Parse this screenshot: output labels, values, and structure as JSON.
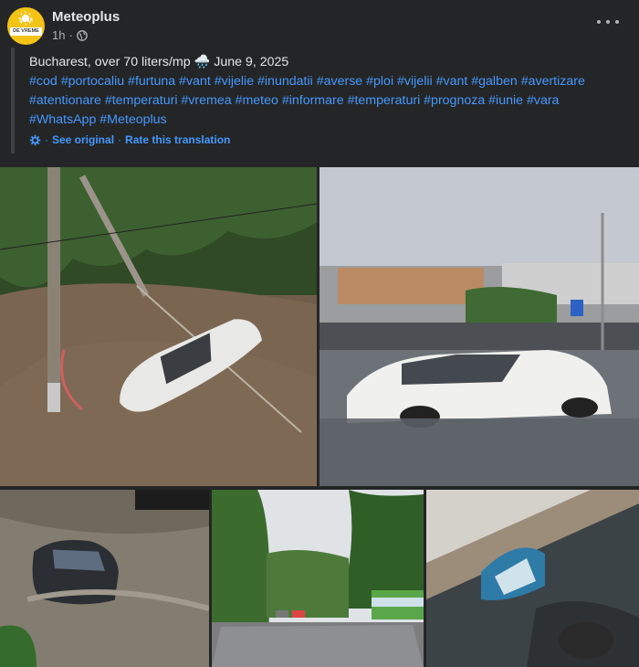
{
  "post": {
    "page_name": "Meteoplus",
    "time": "1h",
    "avatar_text_top": "Sunlit",
    "avatar_text_bottom": "DE VREME",
    "line1_text": "Bucharest, over 70 liters/mp",
    "line1_emoji": "🌧️",
    "line1_date": "June 9, 2025",
    "hashtags": "#cod #portocaliu #furtuna #vant #vijelie #inundatii #averse #ploi #vijelii #vant #galben #avertizare #atentionare #temperaturi #vremea #meteo #informare #temperaturi #prognoza #iunie #vara #WhatsApp #Meteoplus",
    "see_original": "See original",
    "separator": "·",
    "rate_translation": "Rate this translation"
  },
  "colors": {
    "background": "#242526",
    "link": "#4599ff",
    "secondary_text": "#b0b3b8",
    "primary_text": "#e4e6eb"
  },
  "icons": [
    "privacy-globe-icon",
    "more-options-icon",
    "translate-gear-icon"
  ]
}
